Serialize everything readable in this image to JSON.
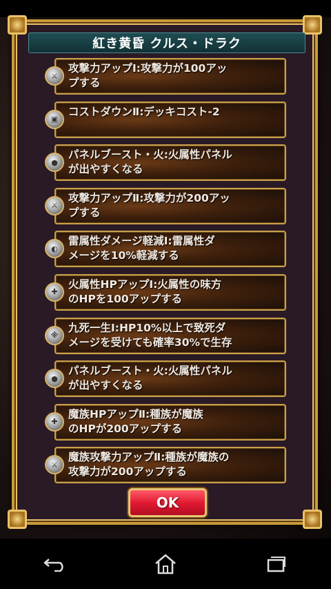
{
  "dialog": {
    "title": "紅き黄昏 クルス・ドラク",
    "ok_label": "OK"
  },
  "skills": [
    {
      "icon": "attack-up-icon",
      "glyph": "⚔",
      "text": "攻撃力アップⅠ:攻撃力が100アッ\nプする"
    },
    {
      "icon": "cost-down-icon",
      "glyph": "▣",
      "text": "コストダウンⅡ:デッキコスト-2"
    },
    {
      "icon": "panel-boost-icon",
      "glyph": "●",
      "text": "パネルブースト・火:火属性パネル\nが出やすくなる"
    },
    {
      "icon": "attack-up-icon",
      "glyph": "⚔",
      "text": "攻撃力アップⅡ:攻撃力が200アッ\nプする"
    },
    {
      "icon": "damage-reduce-icon",
      "glyph": "◐",
      "text": "雷属性ダメージ軽減Ⅰ:雷属性ダ\nメージを10%軽減する"
    },
    {
      "icon": "hp-up-icon",
      "glyph": "✚",
      "text": "火属性HPアップⅠ:火属性の味方\nのHPを100アップする"
    },
    {
      "icon": "survive-icon",
      "glyph": "※",
      "text": "九死一生Ⅰ:HP10%以上で致死ダ\nメージを受けても確率30%で生存"
    },
    {
      "icon": "panel-boost-icon",
      "glyph": "●",
      "text": "パネルブースト・火:火属性パネル\nが出やすくなる"
    },
    {
      "icon": "hp-up-icon",
      "glyph": "✚",
      "text": "魔族HPアップⅡ:種族が魔族\nのHPが200アップする"
    },
    {
      "icon": "attack-up-icon",
      "glyph": "⚔",
      "text": "魔族攻撃力アップⅡ:種族が魔族の\n攻撃力が200アップする"
    }
  ],
  "nav": {
    "back_icon": "back-icon",
    "home_icon": "home-icon",
    "recents_icon": "recents-icon"
  },
  "colors": {
    "frame_gold": "#c99a3a",
    "title_teal": "#1f4d52",
    "ok_red": "#e21a33"
  }
}
